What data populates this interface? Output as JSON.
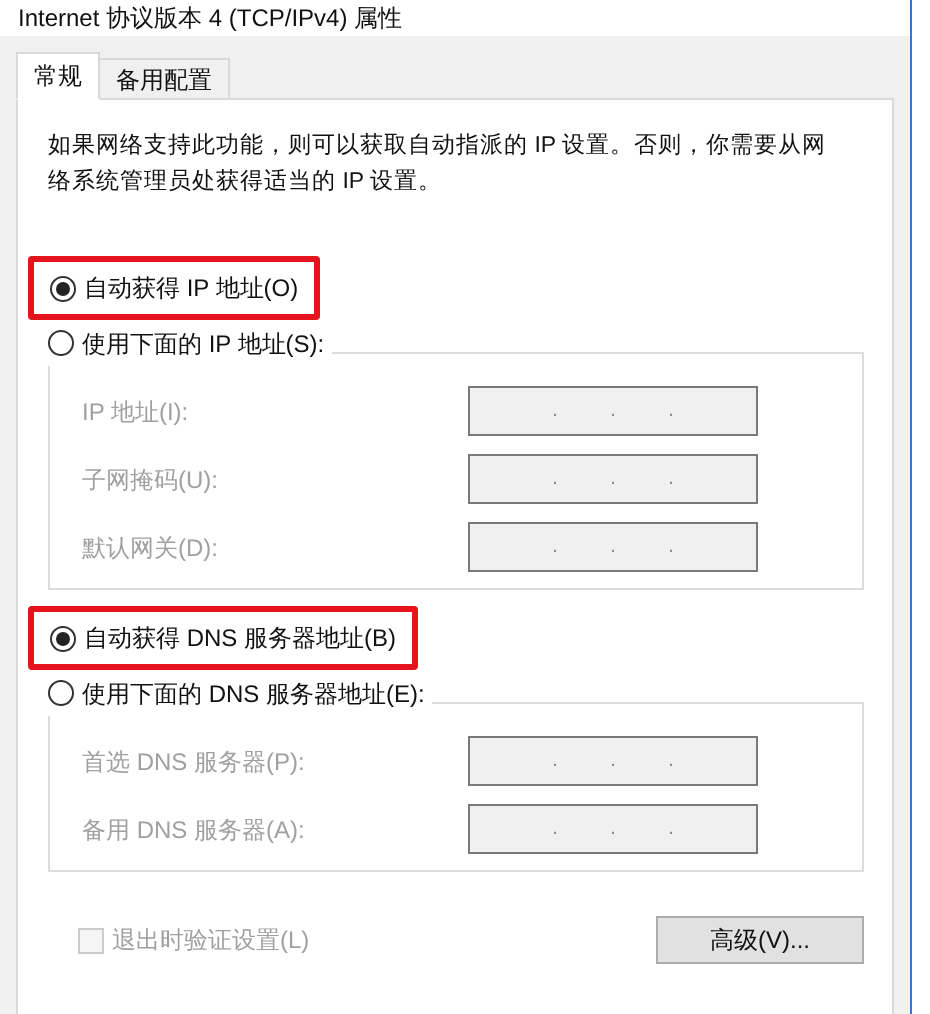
{
  "window": {
    "title": "Internet 协议版本 4 (TCP/IPv4) 属性"
  },
  "tabs": [
    {
      "label": "常规",
      "selected": true
    },
    {
      "label": "备用配置",
      "selected": false
    }
  ],
  "intro": "如果网络支持此功能，则可以获取自动指派的 IP 设置。否则，你需要从网络系统管理员处获得适当的 IP 设置。",
  "sections": [
    {
      "auto": {
        "label": "自动获得 IP 地址(O)",
        "selected": true,
        "highlighted": true
      },
      "manual": {
        "label": "使用下面的 IP 地址(S):",
        "selected": false
      },
      "disabled": true,
      "fields": [
        {
          "label": "IP 地址(I):",
          "separators": [
            ".",
            ".",
            "."
          ]
        },
        {
          "label": "子网掩码(U):",
          "separators": [
            ".",
            ".",
            "."
          ]
        },
        {
          "label": "默认网关(D):",
          "separators": [
            ".",
            ".",
            "."
          ]
        }
      ]
    },
    {
      "auto": {
        "label": "自动获得 DNS 服务器地址(B)",
        "selected": true,
        "highlighted": true
      },
      "manual": {
        "label": "使用下面的 DNS 服务器地址(E):",
        "selected": false
      },
      "disabled": true,
      "fields": [
        {
          "label": "首选 DNS 服务器(P):",
          "separators": [
            ".",
            ".",
            "."
          ]
        },
        {
          "label": "备用 DNS 服务器(A):",
          "separators": [
            ".",
            ".",
            "."
          ]
        }
      ]
    }
  ],
  "validate": {
    "label": "退出时验证设置(L)",
    "checked": false,
    "disabled": true
  },
  "advanced_button": "高级(V)..."
}
